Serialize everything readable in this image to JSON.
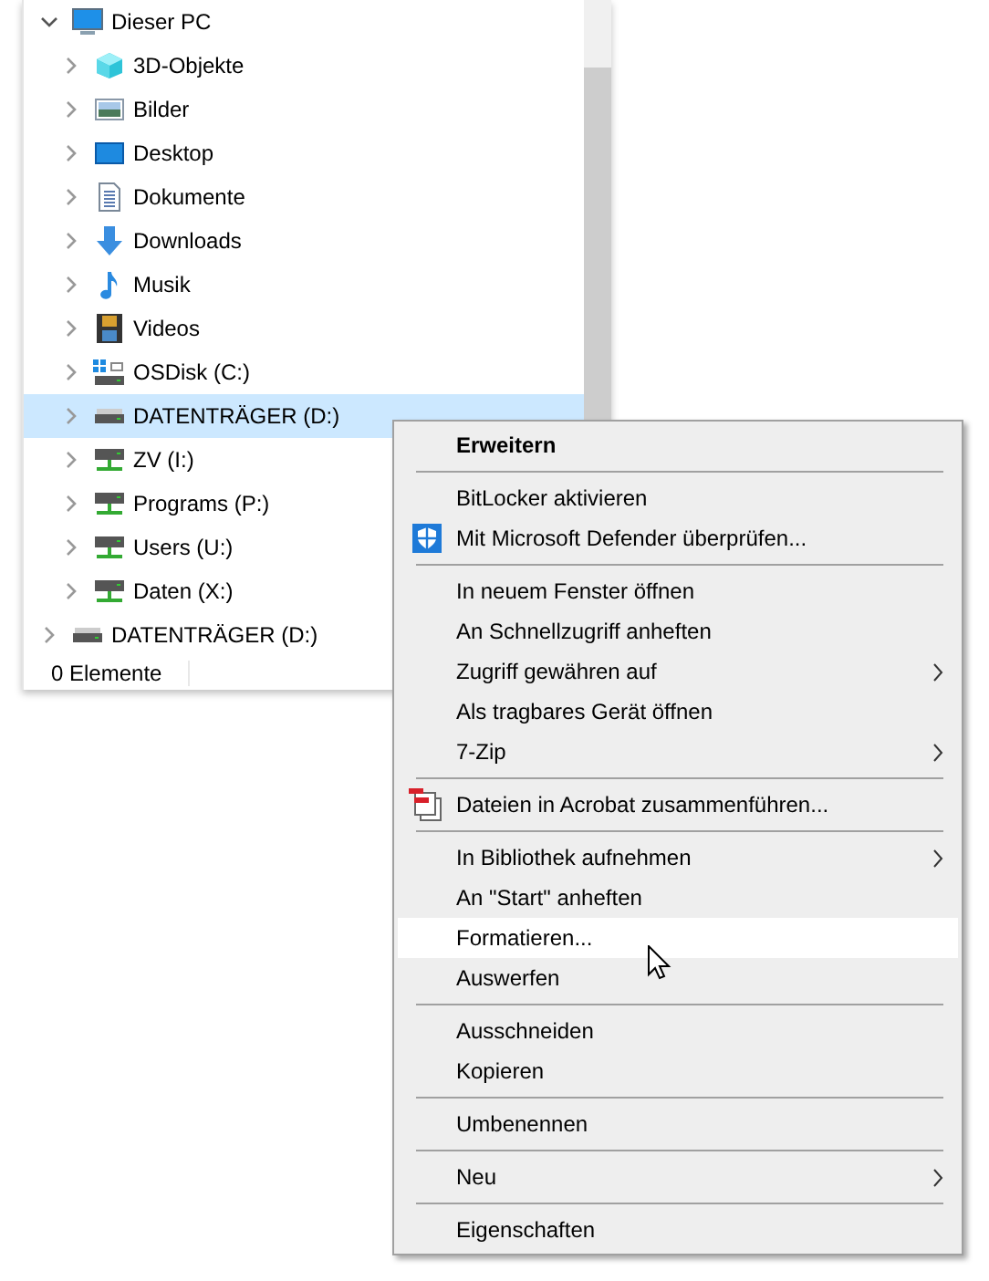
{
  "navigation_tree": [
    {
      "label": "Dieser PC",
      "expanded": true,
      "selected": false,
      "children": [
        {
          "label": "3D-Objekte",
          "expanded": false,
          "selected": false
        },
        {
          "label": "Bilder",
          "expanded": false,
          "selected": false
        },
        {
          "label": "Desktop",
          "expanded": false,
          "selected": false
        },
        {
          "label": "Dokumente",
          "expanded": false,
          "selected": false
        },
        {
          "label": "Downloads",
          "expanded": false,
          "selected": false
        },
        {
          "label": "Musik",
          "expanded": false,
          "selected": false
        },
        {
          "label": "Videos",
          "expanded": false,
          "selected": false
        },
        {
          "label": "OSDisk (C:)",
          "expanded": false,
          "selected": false
        },
        {
          "label": "DATENTRÄGER (D:)",
          "expanded": false,
          "selected": true
        },
        {
          "label": "ZV (I:)",
          "expanded": false,
          "selected": false
        },
        {
          "label": "Programs (P:)",
          "expanded": false,
          "selected": false
        },
        {
          "label": "Users (U:)",
          "expanded": false,
          "selected": false
        },
        {
          "label": "Daten (X:)",
          "expanded": false,
          "selected": false
        }
      ]
    },
    {
      "label": "DATENTRÄGER (D:)",
      "expanded": false,
      "selected": false
    }
  ],
  "status_bar": {
    "item_count": "0 Elemente"
  },
  "context_menu": [
    {
      "kind": "item",
      "label": "Erweitern",
      "bold": true,
      "submenu": false,
      "highlighted": false
    },
    {
      "kind": "separator"
    },
    {
      "kind": "item",
      "label": "BitLocker aktivieren",
      "bold": false,
      "submenu": false,
      "highlighted": false
    },
    {
      "kind": "item",
      "label": "Mit Microsoft Defender überprüfen...",
      "bold": false,
      "submenu": false,
      "highlighted": false
    },
    {
      "kind": "separator"
    },
    {
      "kind": "item",
      "label": "In neuem Fenster öffnen",
      "bold": false,
      "submenu": false,
      "highlighted": false
    },
    {
      "kind": "item",
      "label": "An Schnellzugriff anheften",
      "bold": false,
      "submenu": false,
      "highlighted": false
    },
    {
      "kind": "item",
      "label": "Zugriff gewähren auf",
      "bold": false,
      "submenu": true,
      "highlighted": false
    },
    {
      "kind": "item",
      "label": "Als tragbares Gerät öffnen",
      "bold": false,
      "submenu": false,
      "highlighted": false
    },
    {
      "kind": "item",
      "label": "7-Zip",
      "bold": false,
      "submenu": true,
      "highlighted": false
    },
    {
      "kind": "separator"
    },
    {
      "kind": "item",
      "label": "Dateien in Acrobat zusammenführen...",
      "bold": false,
      "submenu": false,
      "highlighted": false
    },
    {
      "kind": "separator"
    },
    {
      "kind": "item",
      "label": "In Bibliothek aufnehmen",
      "bold": false,
      "submenu": true,
      "highlighted": false
    },
    {
      "kind": "item",
      "label": "An \"Start\" anheften",
      "bold": false,
      "submenu": false,
      "highlighted": false
    },
    {
      "kind": "item",
      "label": "Formatieren...",
      "bold": false,
      "submenu": false,
      "highlighted": true
    },
    {
      "kind": "item",
      "label": "Auswerfen",
      "bold": false,
      "submenu": false,
      "highlighted": false
    },
    {
      "kind": "separator"
    },
    {
      "kind": "item",
      "label": "Ausschneiden",
      "bold": false,
      "submenu": false,
      "highlighted": false
    },
    {
      "kind": "item",
      "label": "Kopieren",
      "bold": false,
      "submenu": false,
      "highlighted": false
    },
    {
      "kind": "separator"
    },
    {
      "kind": "item",
      "label": "Umbenennen",
      "bold": false,
      "submenu": false,
      "highlighted": false
    },
    {
      "kind": "separator"
    },
    {
      "kind": "item",
      "label": "Neu",
      "bold": false,
      "submenu": true,
      "highlighted": false
    },
    {
      "kind": "separator"
    },
    {
      "kind": "item",
      "label": "Eigenschaften",
      "bold": false,
      "submenu": false,
      "highlighted": false
    }
  ]
}
